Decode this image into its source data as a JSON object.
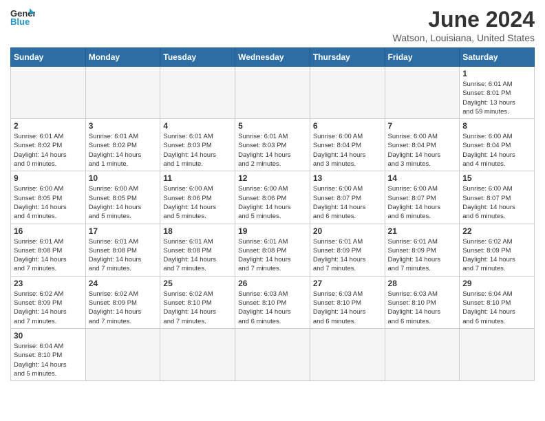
{
  "header": {
    "logo_general": "General",
    "logo_blue": "Blue",
    "month_title": "June 2024",
    "location": "Watson, Louisiana, United States"
  },
  "days_of_week": [
    "Sunday",
    "Monday",
    "Tuesday",
    "Wednesday",
    "Thursday",
    "Friday",
    "Saturday"
  ],
  "weeks": [
    [
      {
        "day": "",
        "empty": true
      },
      {
        "day": "",
        "empty": true
      },
      {
        "day": "",
        "empty": true
      },
      {
        "day": "",
        "empty": true
      },
      {
        "day": "",
        "empty": true
      },
      {
        "day": "",
        "empty": true
      },
      {
        "day": "1",
        "info": "Sunrise: 6:01 AM\nSunset: 8:01 PM\nDaylight: 13 hours\nand 59 minutes."
      }
    ],
    [
      {
        "day": "2",
        "info": "Sunrise: 6:01 AM\nSunset: 8:02 PM\nDaylight: 14 hours\nand 0 minutes."
      },
      {
        "day": "3",
        "info": "Sunrise: 6:01 AM\nSunset: 8:02 PM\nDaylight: 14 hours\nand 1 minute."
      },
      {
        "day": "4",
        "info": "Sunrise: 6:01 AM\nSunset: 8:03 PM\nDaylight: 14 hours\nand 1 minute."
      },
      {
        "day": "5",
        "info": "Sunrise: 6:01 AM\nSunset: 8:03 PM\nDaylight: 14 hours\nand 2 minutes."
      },
      {
        "day": "6",
        "info": "Sunrise: 6:00 AM\nSunset: 8:04 PM\nDaylight: 14 hours\nand 3 minutes."
      },
      {
        "day": "7",
        "info": "Sunrise: 6:00 AM\nSunset: 8:04 PM\nDaylight: 14 hours\nand 3 minutes."
      },
      {
        "day": "8",
        "info": "Sunrise: 6:00 AM\nSunset: 8:04 PM\nDaylight: 14 hours\nand 4 minutes."
      }
    ],
    [
      {
        "day": "9",
        "info": "Sunrise: 6:00 AM\nSunset: 8:05 PM\nDaylight: 14 hours\nand 4 minutes."
      },
      {
        "day": "10",
        "info": "Sunrise: 6:00 AM\nSunset: 8:05 PM\nDaylight: 14 hours\nand 5 minutes."
      },
      {
        "day": "11",
        "info": "Sunrise: 6:00 AM\nSunset: 8:06 PM\nDaylight: 14 hours\nand 5 minutes."
      },
      {
        "day": "12",
        "info": "Sunrise: 6:00 AM\nSunset: 8:06 PM\nDaylight: 14 hours\nand 5 minutes."
      },
      {
        "day": "13",
        "info": "Sunrise: 6:00 AM\nSunset: 8:07 PM\nDaylight: 14 hours\nand 6 minutes."
      },
      {
        "day": "14",
        "info": "Sunrise: 6:00 AM\nSunset: 8:07 PM\nDaylight: 14 hours\nand 6 minutes."
      },
      {
        "day": "15",
        "info": "Sunrise: 6:00 AM\nSunset: 8:07 PM\nDaylight: 14 hours\nand 6 minutes."
      }
    ],
    [
      {
        "day": "16",
        "info": "Sunrise: 6:01 AM\nSunset: 8:08 PM\nDaylight: 14 hours\nand 7 minutes."
      },
      {
        "day": "17",
        "info": "Sunrise: 6:01 AM\nSunset: 8:08 PM\nDaylight: 14 hours\nand 7 minutes."
      },
      {
        "day": "18",
        "info": "Sunrise: 6:01 AM\nSunset: 8:08 PM\nDaylight: 14 hours\nand 7 minutes."
      },
      {
        "day": "19",
        "info": "Sunrise: 6:01 AM\nSunset: 8:08 PM\nDaylight: 14 hours\nand 7 minutes."
      },
      {
        "day": "20",
        "info": "Sunrise: 6:01 AM\nSunset: 8:09 PM\nDaylight: 14 hours\nand 7 minutes."
      },
      {
        "day": "21",
        "info": "Sunrise: 6:01 AM\nSunset: 8:09 PM\nDaylight: 14 hours\nand 7 minutes."
      },
      {
        "day": "22",
        "info": "Sunrise: 6:02 AM\nSunset: 8:09 PM\nDaylight: 14 hours\nand 7 minutes."
      }
    ],
    [
      {
        "day": "23",
        "info": "Sunrise: 6:02 AM\nSunset: 8:09 PM\nDaylight: 14 hours\nand 7 minutes."
      },
      {
        "day": "24",
        "info": "Sunrise: 6:02 AM\nSunset: 8:09 PM\nDaylight: 14 hours\nand 7 minutes."
      },
      {
        "day": "25",
        "info": "Sunrise: 6:02 AM\nSunset: 8:10 PM\nDaylight: 14 hours\nand 7 minutes."
      },
      {
        "day": "26",
        "info": "Sunrise: 6:03 AM\nSunset: 8:10 PM\nDaylight: 14 hours\nand 6 minutes."
      },
      {
        "day": "27",
        "info": "Sunrise: 6:03 AM\nSunset: 8:10 PM\nDaylight: 14 hours\nand 6 minutes."
      },
      {
        "day": "28",
        "info": "Sunrise: 6:03 AM\nSunset: 8:10 PM\nDaylight: 14 hours\nand 6 minutes."
      },
      {
        "day": "29",
        "info": "Sunrise: 6:04 AM\nSunset: 8:10 PM\nDaylight: 14 hours\nand 6 minutes."
      }
    ],
    [
      {
        "day": "30",
        "info": "Sunrise: 6:04 AM\nSunset: 8:10 PM\nDaylight: 14 hours\nand 5 minutes."
      },
      {
        "day": "",
        "empty": true
      },
      {
        "day": "",
        "empty": true
      },
      {
        "day": "",
        "empty": true
      },
      {
        "day": "",
        "empty": true
      },
      {
        "day": "",
        "empty": true
      },
      {
        "day": "",
        "empty": true
      }
    ]
  ]
}
